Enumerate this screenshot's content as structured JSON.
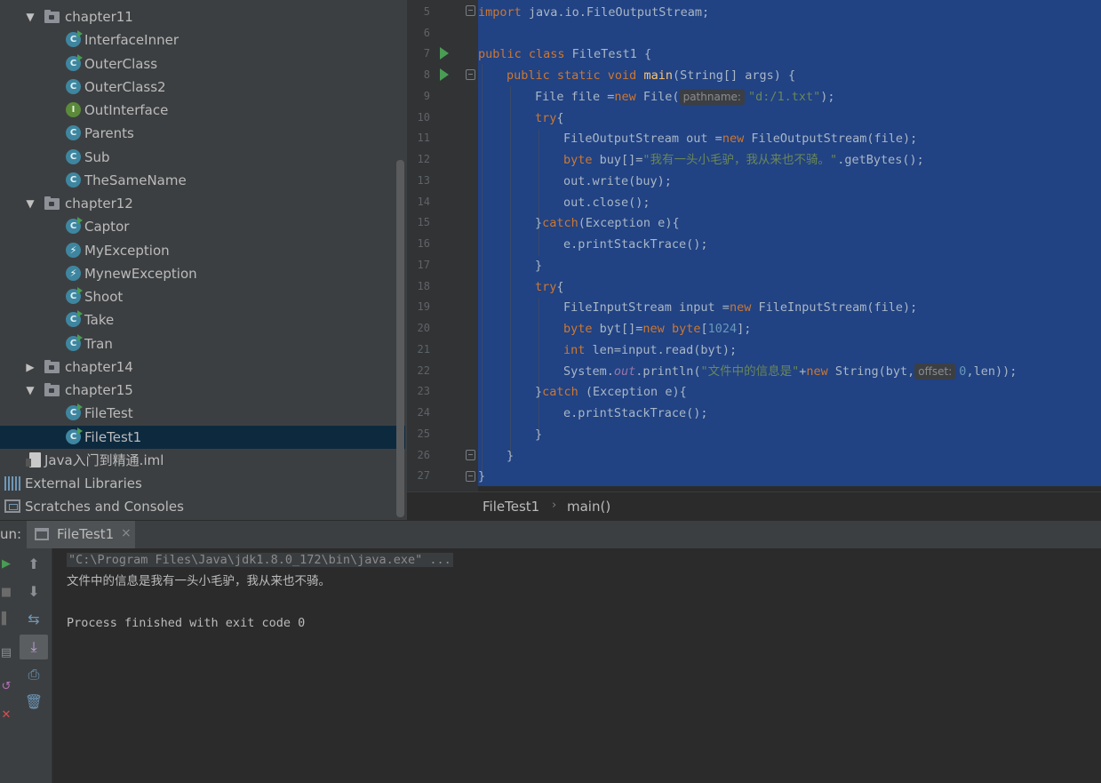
{
  "project_tree": {
    "items": [
      {
        "kind": "folder",
        "label": "chapter11",
        "expanded": true
      },
      {
        "kind": "class",
        "label": "InterfaceInner"
      },
      {
        "kind": "class",
        "label": "OuterClass"
      },
      {
        "kind": "class",
        "label": "OuterClass2"
      },
      {
        "kind": "interface",
        "label": "OutInterface"
      },
      {
        "kind": "class",
        "label": "Parents"
      },
      {
        "kind": "class",
        "label": "Sub"
      },
      {
        "kind": "class",
        "label": "TheSameName"
      },
      {
        "kind": "folder",
        "label": "chapter12",
        "expanded": true
      },
      {
        "kind": "class",
        "label": "Captor"
      },
      {
        "kind": "exception",
        "label": "MyException"
      },
      {
        "kind": "exception",
        "label": "MynewException"
      },
      {
        "kind": "class",
        "label": "Shoot"
      },
      {
        "kind": "class",
        "label": "Take"
      },
      {
        "kind": "class",
        "label": "Tran"
      },
      {
        "kind": "folder",
        "label": "chapter14",
        "expanded": false
      },
      {
        "kind": "folder",
        "label": "chapter15",
        "expanded": true
      },
      {
        "kind": "class",
        "label": "FileTest"
      },
      {
        "kind": "class",
        "label": "FileTest1",
        "selected": true
      },
      {
        "kind": "iml",
        "label": "Java入门到精通.iml"
      },
      {
        "kind": "libraries",
        "label": "External Libraries"
      },
      {
        "kind": "scratches",
        "label": "Scratches and Consoles"
      }
    ]
  },
  "editor": {
    "line_numbers": [
      "5",
      "6",
      "7",
      "8",
      "9",
      "10",
      "11",
      "12",
      "13",
      "14",
      "15",
      "16",
      "17",
      "18",
      "19",
      "20",
      "21",
      "22",
      "23",
      "24",
      "25",
      "26",
      "27"
    ],
    "code": {
      "l5_kw": "import",
      "l5_rest": " java.io.FileOutputStream;",
      "l7_kw": "public class",
      "l7_rest": " FileTest1 {",
      "l8_kw": "public static void",
      "l8_fn": "main",
      "l8_rest": "(String[] args) {",
      "l9_a": "File file =",
      "l9_kw": "new",
      "l9_b": " File(",
      "l9_hint": "pathname:",
      "l9_str": "\"d:/1.txt\"",
      "l9_c": ");",
      "l10_kw": "try",
      "l10_rest": "{",
      "l11_a": "FileOutputStream out =",
      "l11_kw": "new",
      "l11_b": " FileOutputStream(file);",
      "l12_kw": "byte",
      "l12_a": " buy[]=",
      "l12_str": "\"我有一头小毛驴，我从来也不骑。\"",
      "l12_b": ".getBytes();",
      "l13": "out.write(buy);",
      "l14": "out.close();",
      "l15_a": "}",
      "l15_kw": "catch",
      "l15_b": "(Exception e){",
      "l16": "e.printStackTrace();",
      "l17": "}",
      "l18_kw": "try",
      "l18_rest": "{",
      "l19_a": "FileInputStream input =",
      "l19_kw": "new",
      "l19_b": " FileInputStream(file);",
      "l20_kw": "byte",
      "l20_a": " byt[]=",
      "l20_kw2": "new",
      "l20_kw3": " byte",
      "l20_b": "[",
      "l20_num": "1024",
      "l20_c": "];",
      "l21_kw": "int",
      "l21_rest": " len=input.read(byt);",
      "l22_a": "System.",
      "l22_field": "out",
      "l22_b": ".println(",
      "l22_str": "\"文件中的信息是\"",
      "l22_c": "+",
      "l22_kw": "new",
      "l22_d": " String(byt,",
      "l22_hint": "offset:",
      "l22_num": "0",
      "l22_e": ",len));",
      "l23_a": "}",
      "l23_kw": "catch",
      "l23_b": " (Exception e){",
      "l24": "e.printStackTrace();",
      "l25": "}",
      "l26": "}",
      "l27": "}"
    }
  },
  "breadcrumb": {
    "class_name": "FileTest1",
    "separator": "›",
    "method": "main()"
  },
  "run_panel": {
    "label": "un:",
    "tab_label": "FileTest1",
    "tab_close": "×",
    "console": {
      "command": "\"C:\\Program Files\\Java\\jdk1.8.0_172\\bin\\java.exe\" ...",
      "output": "文件中的信息是我有一头小毛驴，我从来也不骑。",
      "exit": "Process finished with exit code 0"
    }
  },
  "colors": {
    "selection": "#214283",
    "keyword": "#cc7832",
    "string": "#6a8759",
    "number": "#6897bb",
    "method": "#ffc66d"
  }
}
